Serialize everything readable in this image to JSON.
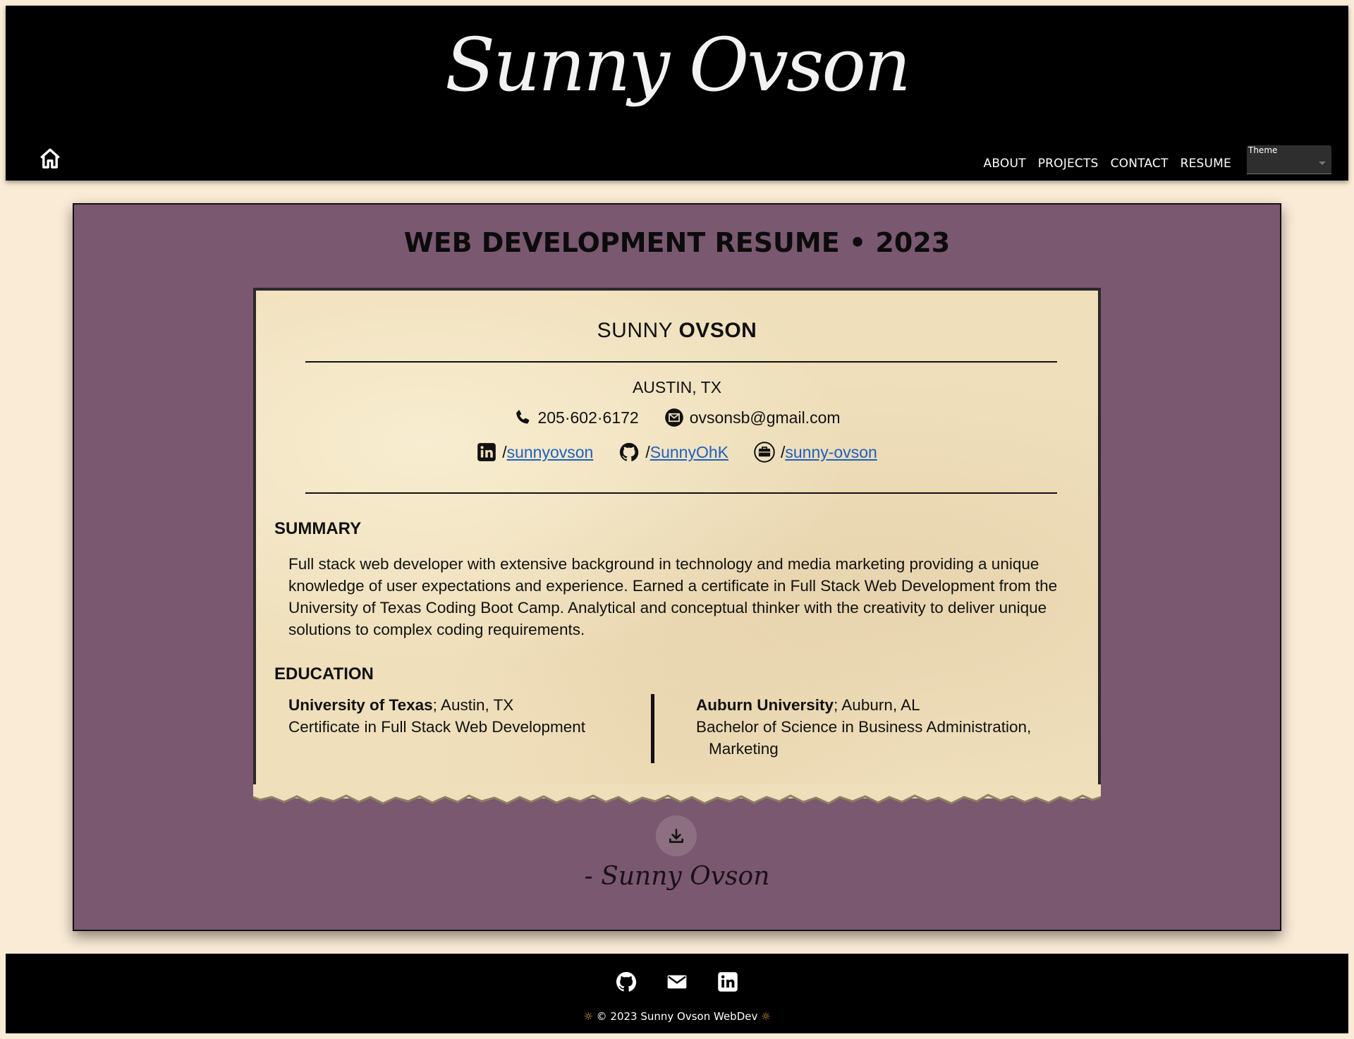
{
  "header": {
    "brand": "Sunny Ovson",
    "nav": [
      "ABOUT",
      "PROJECTS",
      "CONTACT",
      "RESUME"
    ],
    "theme_label": "Theme",
    "theme_value": ""
  },
  "main": {
    "title": "WEB DEVELOPMENT RESUME • 2023",
    "resume": {
      "first_name": "SUNNY ",
      "last_name": "OVSON",
      "location": "AUSTIN, TX",
      "phone": "205·602·6172",
      "email": "ovsonsb@gmail.com",
      "linkedin": "sunnyovson",
      "github": "SunnyOhK",
      "portfolio": "sunny-ovson",
      "slash": "/",
      "summary_heading": "SUMMARY",
      "summary_text": "Full stack web developer with extensive background in technology and media marketing providing a unique knowledge of user expectations and experience. Earned a certificate in Full Stack Web Development from the University of Texas Coding Boot Camp. Analytical and conceptual thinker with the creativity to deliver unique solutions to complex coding requirements.",
      "education_heading": "EDUCATION",
      "education": [
        {
          "school": "University of Texas",
          "place": "; Austin, TX",
          "degree": "Certificate in Full Stack Web Development",
          "degree_cont": ""
        },
        {
          "school": "Auburn University",
          "place": "; Auburn, AL",
          "degree": "Bachelor of Science in Business Administration,",
          "degree_cont": "Marketing"
        }
      ]
    },
    "signature": "- Sunny Ovson"
  },
  "footer": {
    "copyright": "© 2023 Sunny Ovson WebDev",
    "sun_glyph": "☼"
  }
}
